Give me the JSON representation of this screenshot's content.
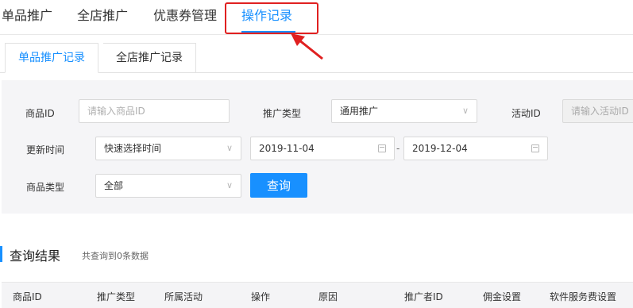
{
  "top_tabs": [
    {
      "label": "单品推广"
    },
    {
      "label": "全店推广"
    },
    {
      "label": "优惠券管理"
    },
    {
      "label": "操作记录"
    }
  ],
  "sub_tabs": [
    {
      "label": "单品推广记录"
    },
    {
      "label": "全店推广记录"
    }
  ],
  "filters": {
    "product_id": {
      "label": "商品ID",
      "placeholder": "请输入商品ID"
    },
    "promo_type": {
      "label": "推广类型",
      "value": "通用推广"
    },
    "activity_id": {
      "label": "活动ID",
      "placeholder": "请输入活动ID"
    },
    "update_time": {
      "label": "更新时间",
      "value": "快速选择时间",
      "start_date": "2019-11-04",
      "end_date": "2019-12-04",
      "separator": "-"
    },
    "product_type": {
      "label": "商品类型",
      "value": "全部"
    },
    "search_button": "查询"
  },
  "results": {
    "title": "查询结果",
    "count_text": "共查询到0条数据"
  },
  "table": {
    "columns": [
      "商品ID",
      "推广类型",
      "所属活动",
      "操作",
      "原因",
      "推广者ID",
      "佣金设置",
      "软件服务费设置"
    ]
  },
  "colors": {
    "accent": "#1890ff",
    "annotation": "#e02020"
  }
}
